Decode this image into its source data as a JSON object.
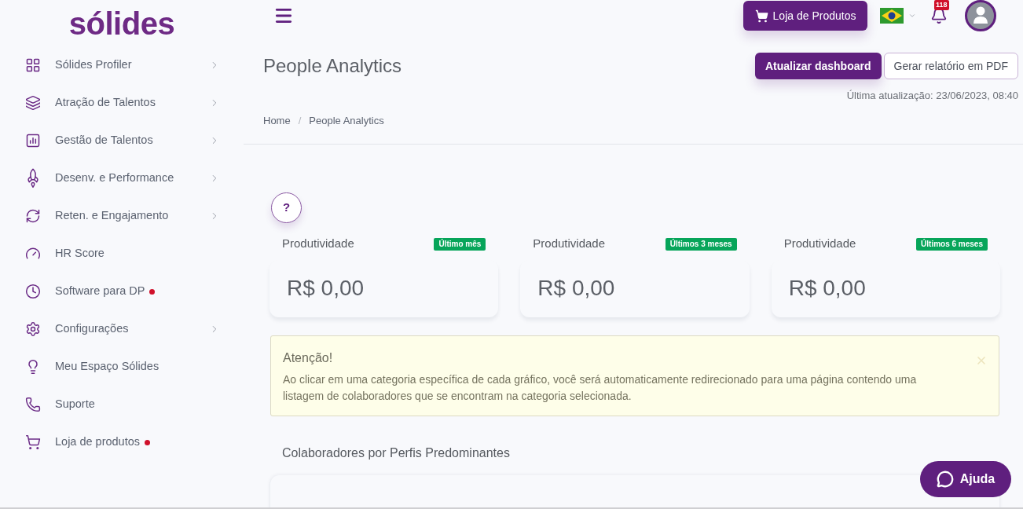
{
  "logo": {
    "text": "sólides"
  },
  "sidebar": {
    "items": [
      {
        "label": "Sólides Profiler",
        "submenu": true,
        "notification_dot": false,
        "selected": false
      },
      {
        "label": "Atração de Talentos",
        "submenu": true,
        "notification_dot": false,
        "selected": false
      },
      {
        "label": "Gestão de Talentos",
        "submenu": true,
        "notification_dot": false,
        "selected": false
      },
      {
        "label": "Desenv. e Performance",
        "submenu": true,
        "notification_dot": false,
        "selected": false
      },
      {
        "label": "Reten. e Engajamento",
        "submenu": true,
        "notification_dot": false,
        "selected": false
      },
      {
        "label": "HR Score",
        "submenu": false,
        "notification_dot": false,
        "selected": false
      },
      {
        "label": "Software para DP",
        "submenu": false,
        "notification_dot": true,
        "selected": false
      },
      {
        "label": "Configurações",
        "submenu": true,
        "notification_dot": false,
        "selected": false
      },
      {
        "label": "Meu Espaço Sólides",
        "submenu": false,
        "notification_dot": false,
        "selected": false
      },
      {
        "label": "Suporte",
        "submenu": false,
        "notification_dot": false,
        "selected": false
      },
      {
        "label": "Loja de produtos",
        "submenu": false,
        "notification_dot": true,
        "selected": false
      }
    ]
  },
  "topbar": {
    "store_button": "Loja de Produtos",
    "notifications": {
      "count": "118"
    }
  },
  "page_header": {
    "title": "People Analytics",
    "buttons": [
      {
        "label": "Atualizar dashboard",
        "kind": "primary"
      },
      {
        "label": "Gerar relatório em PDF",
        "kind": "outline"
      }
    ],
    "last_update": "Última atualização: 23/06/2023, 08:40"
  },
  "breadcrumb": {
    "items": [
      "Home",
      "People Analytics"
    ],
    "separator": "/"
  },
  "help_button": {
    "label": "?"
  },
  "kpis": [
    {
      "label": "Produtividade",
      "period": "Último mês",
      "value": "R$ 0,00"
    },
    {
      "label": "Produtividade",
      "period": "Últimos 3 meses",
      "value": "R$ 0,00"
    },
    {
      "label": "Produtividade",
      "period": "Últimos 6 meses",
      "value": "R$ 0,00"
    }
  ],
  "alert": {
    "title": "Atenção!",
    "message": "Ao clicar em uma categoria específica de cada gráfico, você será automaticamente redirecionado para uma página contendo uma listagem de colaboradores que se encontram na categoria selecionada."
  },
  "section": {
    "title": "Colaboradores por Perfis Predominantes"
  },
  "chat_button": {
    "label": "Ajuda"
  }
}
